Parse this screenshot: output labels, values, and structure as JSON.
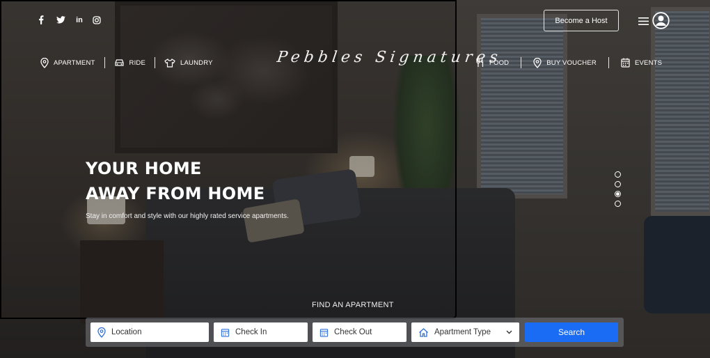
{
  "social": [
    {
      "name": "facebook",
      "glyph": "f"
    },
    {
      "name": "twitter",
      "glyph": "t"
    },
    {
      "name": "linkedin",
      "glyph": "in"
    },
    {
      "name": "instagram",
      "glyph": "ig"
    }
  ],
  "header": {
    "host_label": "Become a Host",
    "brand": "Pebbles Signatures"
  },
  "nav_left": [
    {
      "label": "APARTMENT",
      "icon": "location-pin-icon"
    },
    {
      "label": "RIDE",
      "icon": "car-icon"
    },
    {
      "label": "LAUNDRY",
      "icon": "shirt-icon"
    }
  ],
  "nav_right": [
    {
      "label": "FOOD",
      "icon": "utensils-icon"
    },
    {
      "label": "BUY VOUCHER",
      "icon": "location-pin-icon"
    },
    {
      "label": "EVENTS",
      "icon": "calendar-icon"
    }
  ],
  "hero": {
    "line1": "YOUR HOME",
    "line2": "AWAY FROM HOME",
    "tagline": "Stay in comfort and style with our highly rated service apartments.",
    "find_label": "FIND AN APARTMENT"
  },
  "slider": {
    "count": 4,
    "active_index": 2
  },
  "search": {
    "location_placeholder": "Location",
    "checkin_placeholder": "Check In",
    "checkout_placeholder": "Check Out",
    "type_placeholder": "Apartment Type",
    "button_label": "Search"
  },
  "colors": {
    "accent": "#1a6cf5",
    "field_icon": "#2e6fd8"
  }
}
